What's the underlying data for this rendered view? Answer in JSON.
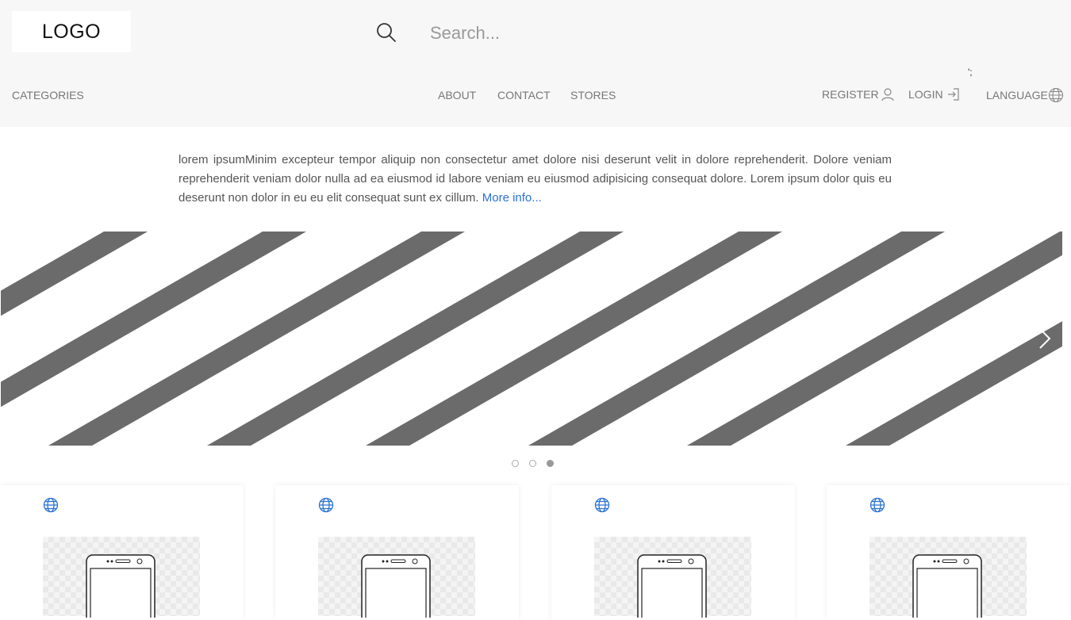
{
  "header": {
    "logo": "LOGO",
    "search": {
      "placeholder": "Search...",
      "value": ""
    },
    "stray_text": "';"
  },
  "nav": {
    "categories": "CATEGORIES",
    "about": "ABOUT",
    "contact": "CONTACT",
    "stores": "STORES",
    "register": "REGISTER",
    "login": "LOGIN",
    "language": "LANGUAGE"
  },
  "intro": {
    "text": "lorem ipsumMinim excepteur tempor aliquip non consectetur amet dolore nisi deserunt velit in dolore reprehenderit. Dolore veniam reprehenderit veniam dolor nulla ad ea eiusmod id labore veniam eu eiusmod adipisicing consequat dolore. Lorem ipsum dolor quis eu deserunt non dolor in eu eu elit consequat sunt ex cillum.",
    "more_link": "More info..."
  },
  "carousel": {
    "slide_count": 3,
    "active_slide": 3
  },
  "cards": [
    {
      "icon": "globe-icon",
      "image": "phone-icon"
    },
    {
      "icon": "globe-icon",
      "image": "phone-icon"
    },
    {
      "icon": "globe-icon",
      "image": "phone-icon"
    },
    {
      "icon": "globe-icon",
      "image": "phone-icon"
    }
  ],
  "colors": {
    "header_bg": "#f7f7f7",
    "link": "#2a72d4",
    "stripe": "#6b6b6b",
    "globe": "#2a72d4"
  }
}
